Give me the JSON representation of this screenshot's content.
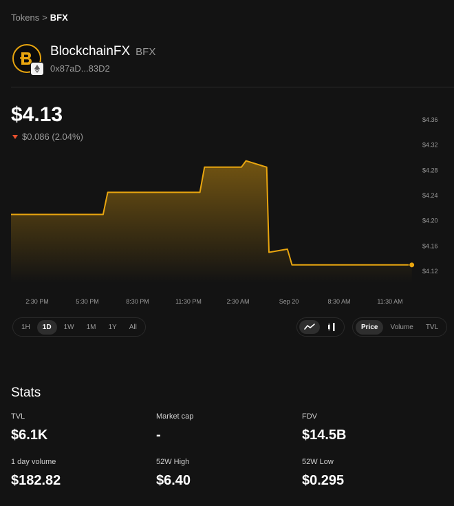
{
  "breadcrumb": {
    "parent": "Tokens",
    "separator": ">",
    "current": "BFX"
  },
  "token": {
    "name": "BlockchainFX",
    "symbol": "BFX",
    "address": "0x87aD...83D2",
    "logo_icon": "bfx-logo-icon",
    "chain_icon": "ethereum-icon",
    "logo_color": "#e8a50f"
  },
  "price": {
    "value": "$4.13",
    "change": "$0.086 (2.04%)",
    "direction": "down",
    "down_color": "#e8502e"
  },
  "chart_data": {
    "type": "area",
    "line_color": "#e8a50f",
    "y_ticks": [
      "$4.36",
      "$4.32",
      "$4.28",
      "$4.24",
      "$4.20",
      "$4.16",
      "$4.12"
    ],
    "ylim": [
      4.12,
      4.36
    ],
    "x_ticks": [
      "2:30 PM",
      "5:30 PM",
      "8:30 PM",
      "11:30 PM",
      "2:30 AM",
      "Sep 20",
      "8:30 AM",
      "11:30 AM"
    ],
    "x": [
      0,
      1.5,
      1.6,
      3.6,
      3.7,
      4.5,
      4.6,
      5.05,
      5.1,
      5.5,
      5.6,
      6.3,
      6.4,
      8.2
    ],
    "values": [
      4.21,
      4.21,
      4.245,
      4.245,
      4.285,
      4.285,
      4.295,
      4.285,
      4.15,
      4.155,
      4.13,
      4.13,
      4.13,
      4.13
    ],
    "xlim": [
      -0.5,
      8.25
    ],
    "grid": false
  },
  "controls": {
    "timeframes": [
      "1H",
      "1D",
      "1W",
      "1M",
      "1Y",
      "All"
    ],
    "selected_timeframe": "1D",
    "chart_styles": [
      "line-chart-icon",
      "candlestick-icon"
    ],
    "selected_chart_style": "line-chart-icon",
    "metrics": [
      "Price",
      "Volume",
      "TVL"
    ],
    "selected_metric": "Price"
  },
  "stats": {
    "title": "Stats",
    "tvl": {
      "label": "TVL",
      "value": "$6.1K"
    },
    "market_cap": {
      "label": "Market cap",
      "value": "-"
    },
    "fdv": {
      "label": "FDV",
      "value": "$14.5B"
    },
    "volume": {
      "label": "1 day volume",
      "value": "$182.82"
    },
    "high": {
      "label": "52W High",
      "value": "$6.40"
    },
    "low": {
      "label": "52W Low",
      "value": "$0.295"
    }
  }
}
